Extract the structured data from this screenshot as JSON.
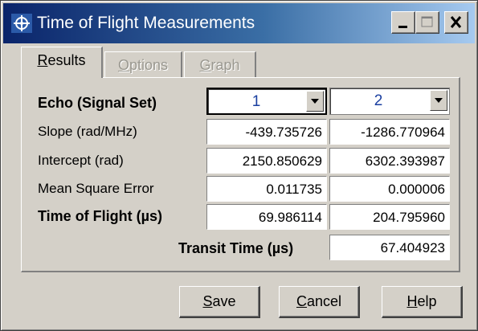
{
  "window": {
    "title": "Time of Flight Measurements",
    "controls": [
      "minimize-icon",
      "maximize-icon",
      "close-icon"
    ],
    "app_icon": "ship-wheel-icon"
  },
  "tabs": [
    {
      "label_accel": "R",
      "label_rest": "esults",
      "state": "active"
    },
    {
      "label_accel": "O",
      "label_rest": "ptions",
      "state": "disabled"
    },
    {
      "label_accel": "G",
      "label_rest": "raph",
      "state": "disabled"
    }
  ],
  "results": {
    "echo_label": "Echo (Signal Set)",
    "echo_1": "1",
    "echo_2": "2",
    "rows": [
      {
        "label": "Slope (rad/MHz)",
        "v1": "-439.735726",
        "v2": "-1286.770964"
      },
      {
        "label": "Intercept (rad)",
        "v1": "2150.850629",
        "v2": "6302.393987"
      },
      {
        "label": "Mean Square Error",
        "v1": "0.011735",
        "v2": "0.000006"
      },
      {
        "label": "Time of Flight (µs)",
        "v1": "69.986114",
        "v2": "204.795960"
      }
    ],
    "transit_label": "Transit Time (µs)",
    "transit_value": "67.404923"
  },
  "buttons": {
    "save_accel": "S",
    "save_rest": "ave",
    "cancel_accel": "C",
    "cancel_rest": "ancel",
    "help_accel": "H",
    "help_rest": "elp"
  },
  "colors": {
    "title_start": "#0a246a",
    "title_end": "#a6caf0",
    "face": "#d4d0c8",
    "combo_text": "#1a3fa0"
  }
}
